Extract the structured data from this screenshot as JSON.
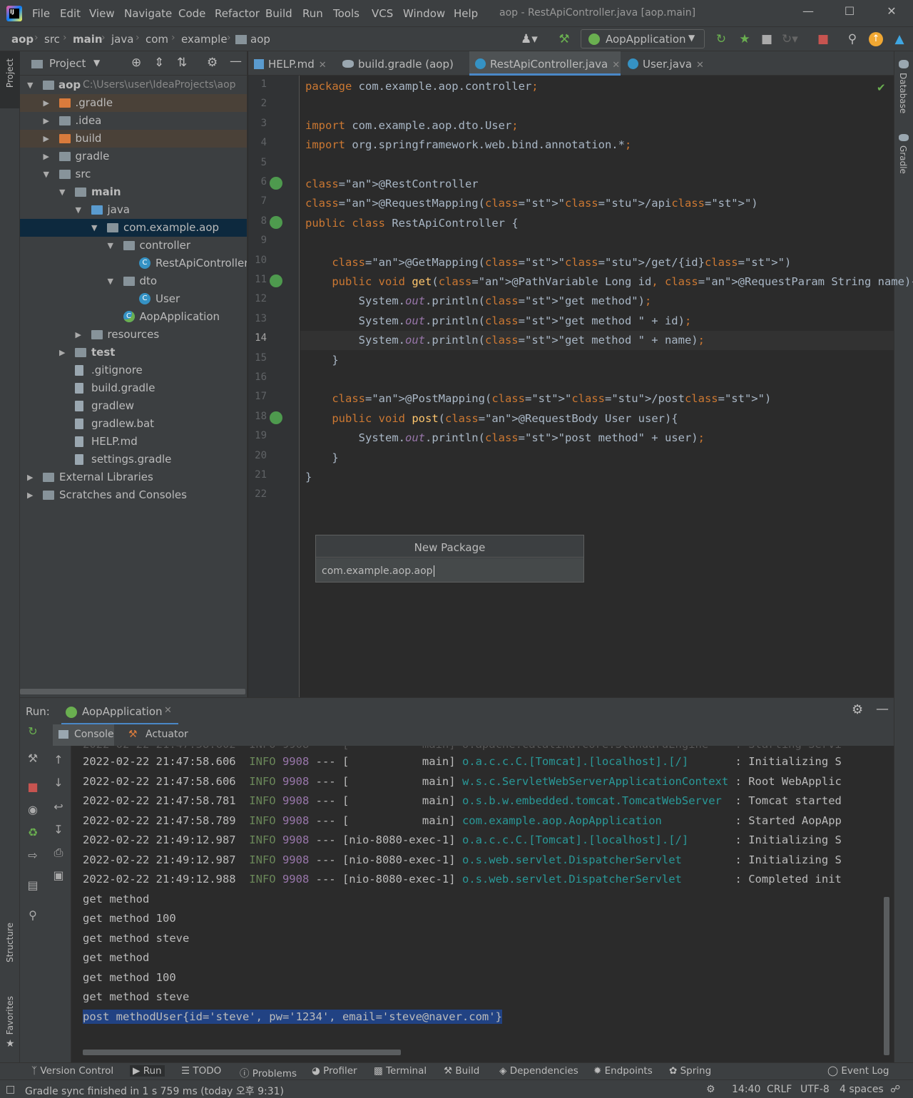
{
  "window": {
    "title": "aop - RestApiController.java [aop.main]",
    "menu": [
      "File",
      "Edit",
      "View",
      "Navigate",
      "Code",
      "Refactor",
      "Build",
      "Run",
      "Tools",
      "VCS",
      "Window",
      "Help"
    ]
  },
  "breadcrumb": [
    "aop",
    "src",
    "main",
    "java",
    "com",
    "example",
    "aop"
  ],
  "run_config": "AopApplication",
  "project_panel": {
    "title": "Project",
    "root_label": "aop",
    "root_path": "C:\\Users\\user\\IdeaProjects\\aop",
    "items": [
      {
        "label": ".gradle",
        "depth": 1,
        "expand": "closed",
        "icon": "folder-orange",
        "highlight": true
      },
      {
        "label": ".idea",
        "depth": 1,
        "expand": "closed",
        "icon": "folder"
      },
      {
        "label": "build",
        "depth": 1,
        "expand": "closed",
        "icon": "folder-orange",
        "highlight": true
      },
      {
        "label": "gradle",
        "depth": 1,
        "expand": "closed",
        "icon": "folder"
      },
      {
        "label": "src",
        "depth": 1,
        "expand": "open",
        "icon": "folder"
      },
      {
        "label": "main",
        "depth": 2,
        "expand": "open",
        "icon": "folder",
        "bold": true
      },
      {
        "label": "java",
        "depth": 3,
        "expand": "open",
        "icon": "folder-blue"
      },
      {
        "label": "com.example.aop",
        "depth": 4,
        "expand": "open",
        "icon": "package",
        "selected": true
      },
      {
        "label": "controller",
        "depth": 5,
        "expand": "open",
        "icon": "package"
      },
      {
        "label": "RestApiController",
        "depth": 6,
        "expand": "none",
        "icon": "class"
      },
      {
        "label": "dto",
        "depth": 5,
        "expand": "open",
        "icon": "package"
      },
      {
        "label": "User",
        "depth": 6,
        "expand": "none",
        "icon": "class"
      },
      {
        "label": "AopApplication",
        "depth": 5,
        "expand": "none",
        "icon": "spring-class"
      },
      {
        "label": "resources",
        "depth": 3,
        "expand": "closed",
        "icon": "folder"
      },
      {
        "label": "test",
        "depth": 2,
        "expand": "closed",
        "icon": "folder",
        "bold": true
      },
      {
        "label": ".gitignore",
        "depth": 2,
        "expand": "none",
        "icon": "file"
      },
      {
        "label": "build.gradle",
        "depth": 2,
        "expand": "none",
        "icon": "gradle"
      },
      {
        "label": "gradlew",
        "depth": 2,
        "expand": "none",
        "icon": "file"
      },
      {
        "label": "gradlew.bat",
        "depth": 2,
        "expand": "none",
        "icon": "file"
      },
      {
        "label": "HELP.md",
        "depth": 2,
        "expand": "none",
        "icon": "md"
      },
      {
        "label": "settings.gradle",
        "depth": 2,
        "expand": "none",
        "icon": "gradle"
      },
      {
        "label": "External Libraries",
        "depth": 0,
        "expand": "closed",
        "icon": "libraries"
      },
      {
        "label": "Scratches and Consoles",
        "depth": 0,
        "expand": "closed",
        "icon": "scratches"
      }
    ]
  },
  "editor_tabs": [
    {
      "label": "HELP.md",
      "icon": "md"
    },
    {
      "label": "build.gradle (aop)",
      "icon": "gradle"
    },
    {
      "label": "RestApiController.java",
      "icon": "class",
      "active": true
    },
    {
      "label": "User.java",
      "icon": "class"
    }
  ],
  "code_lines": [
    "package com.example.aop.controller;",
    "",
    "import com.example.aop.dto.User;",
    "import org.springframework.web.bind.annotation.*;",
    "",
    "@RestController",
    "@RequestMapping(\"/api\")",
    "public class RestApiController {",
    "",
    "    @GetMapping(\"/get/{id}\")",
    "    public void get(@PathVariable Long id, @RequestParam String name){",
    "        System.out.println(\"get method\");",
    "        System.out.println(\"get method \" + id);",
    "        System.out.println(\"get method \" + name);",
    "    }",
    "",
    "    @PostMapping(\"/post\")",
    "    public void post(@RequestBody User user){",
    "        System.out.println(\"post method\" + user);",
    "    }",
    "}",
    ""
  ],
  "current_line": 14,
  "new_package_dialog": {
    "title": "New Package",
    "value": "com.example.aop.aop"
  },
  "run_panel": {
    "label": "Run:",
    "tab": "AopApplication",
    "subtabs": [
      "Console",
      "Actuator"
    ],
    "log_lines": [
      {
        "ts": "2022-02-22 21:47:58.606",
        "level": "INFO",
        "pid": "9908",
        "sep": "---",
        "thread": "[           main]",
        "logger": "o.a.c.c.C.[Tomcat].[localhost].[/]",
        "msg": ": Initializing S"
      },
      {
        "ts": "2022-02-22 21:47:58.606",
        "level": "INFO",
        "pid": "9908",
        "sep": "---",
        "thread": "[           main]",
        "logger": "w.s.c.ServletWebServerApplicationContext",
        "msg": ": Root WebApplic"
      },
      {
        "ts": "2022-02-22 21:47:58.781",
        "level": "INFO",
        "pid": "9908",
        "sep": "---",
        "thread": "[           main]",
        "logger": "o.s.b.w.embedded.tomcat.TomcatWebServer",
        "msg": ": Tomcat started"
      },
      {
        "ts": "2022-02-22 21:47:58.789",
        "level": "INFO",
        "pid": "9908",
        "sep": "---",
        "thread": "[           main]",
        "logger": "com.example.aop.AopApplication",
        "msg": ": Started AopApp"
      },
      {
        "ts": "2022-02-22 21:49:12.987",
        "level": "INFO",
        "pid": "9908",
        "sep": "---",
        "thread": "[nio-8080-exec-1]",
        "logger": "o.a.c.c.C.[Tomcat].[localhost].[/]",
        "msg": ": Initializing S"
      },
      {
        "ts": "2022-02-22 21:49:12.987",
        "level": "INFO",
        "pid": "9908",
        "sep": "---",
        "thread": "[nio-8080-exec-1]",
        "logger": "o.s.web.servlet.DispatcherServlet",
        "msg": ": Initializing S"
      },
      {
        "ts": "2022-02-22 21:49:12.988",
        "level": "INFO",
        "pid": "9908",
        "sep": "---",
        "thread": "[nio-8080-exec-1]",
        "logger": "o.s.web.servlet.DispatcherServlet",
        "msg": ": Completed init"
      }
    ],
    "output_lines": [
      "get method",
      "get method 100",
      "get method steve",
      "get method",
      "get method 100",
      "get method steve",
      "post methodUser{id='steve', pw='1234', email='steve@naver.com'}"
    ]
  },
  "bottom_tools": [
    "Version Control",
    "Run",
    "TODO",
    "Problems",
    "Profiler",
    "Terminal",
    "Build",
    "Dependencies",
    "Endpoints",
    "Spring",
    "Event Log"
  ],
  "left_stripe": [
    "Project",
    "Structure",
    "Favorites"
  ],
  "right_stripe": [
    "Database",
    "Gradle"
  ],
  "status": {
    "message": "Gradle sync finished in 1 s 759 ms (today 오후 9:31)",
    "position": "14:40",
    "line_sep": "CRLF",
    "encoding": "UTF-8",
    "indent": "4 spaces"
  }
}
